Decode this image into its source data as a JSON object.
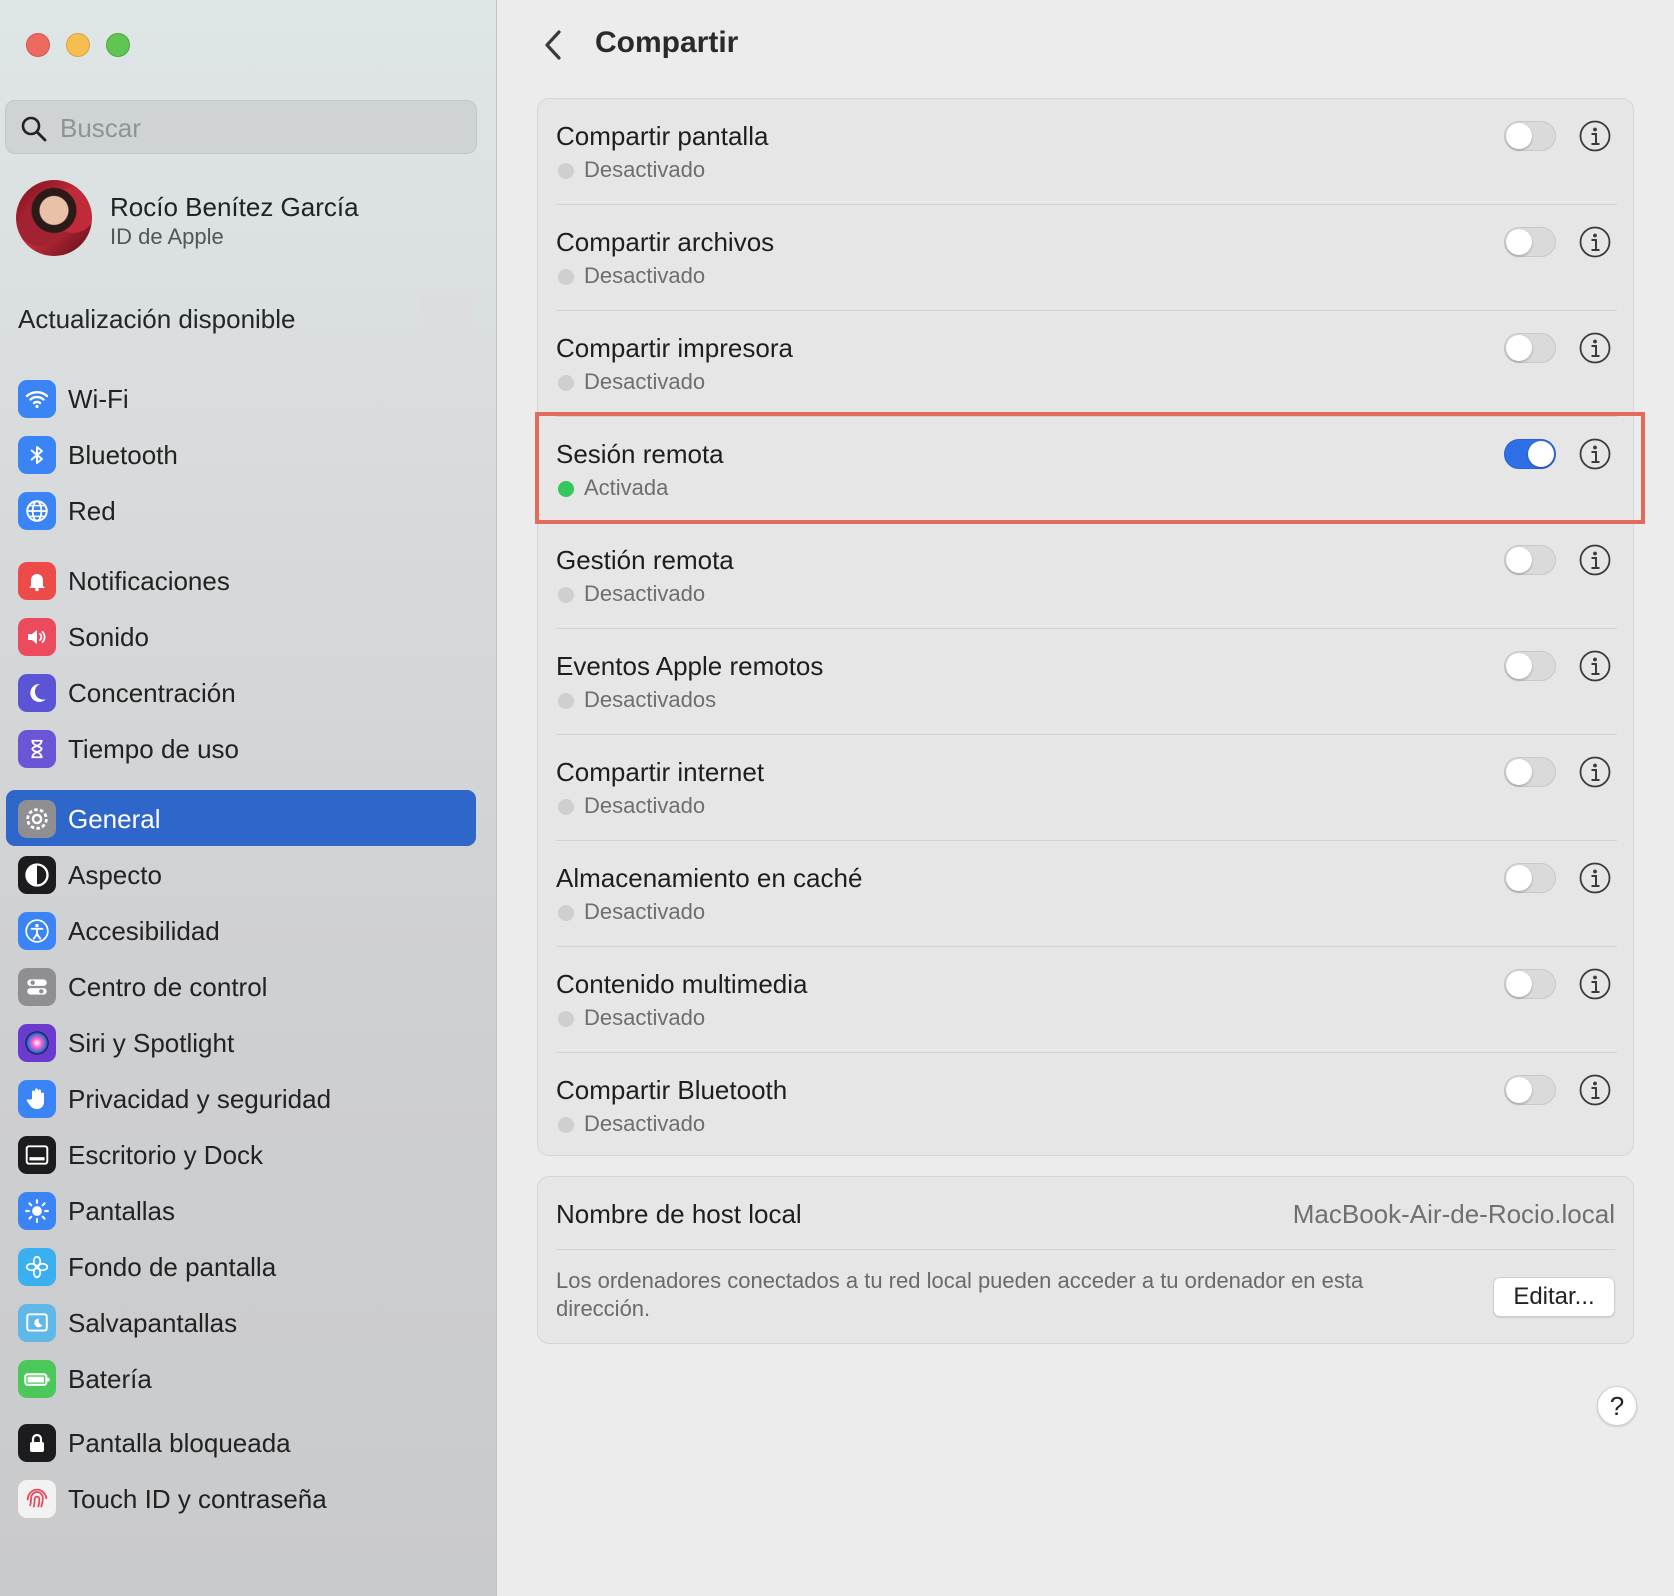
{
  "window": {
    "title": "Compartir"
  },
  "search": {
    "placeholder": "Buscar"
  },
  "profile": {
    "name": "Rocío Benítez García",
    "subtitle": "ID de Apple"
  },
  "sidebar": {
    "update_label": "Actualización disponible",
    "selected": "General",
    "groups": [
      [
        {
          "label": "Wi-Fi",
          "icon": "wifi-icon",
          "color": "#3a84f5"
        },
        {
          "label": "Bluetooth",
          "icon": "bluetooth-icon",
          "color": "#3a84f5"
        },
        {
          "label": "Red",
          "icon": "globe-icon",
          "color": "#3a84f5"
        }
      ],
      [
        {
          "label": "Notificaciones",
          "icon": "bell-icon",
          "color": "#ec4b47"
        },
        {
          "label": "Sonido",
          "icon": "speaker-icon",
          "color": "#ec4b5e"
        },
        {
          "label": "Concentración",
          "icon": "moon-icon",
          "color": "#5b55d6"
        },
        {
          "label": "Tiempo de uso",
          "icon": "hourglass-icon",
          "color": "#6a55d6"
        }
      ],
      [
        {
          "label": "General",
          "icon": "gear-icon",
          "color": "#8e8e93"
        },
        {
          "label": "Aspecto",
          "icon": "appearance-icon",
          "color": "#1c1c1e"
        },
        {
          "label": "Accesibilidad",
          "icon": "accessibility-icon",
          "color": "#3a84f5"
        },
        {
          "label": "Centro de control",
          "icon": "control-center-icon",
          "color": "#8e8e93"
        },
        {
          "label": "Siri y Spotlight",
          "icon": "siri-icon",
          "color": "#6b3bd0"
        },
        {
          "label": "Privacidad y seguridad",
          "icon": "hand-icon",
          "color": "#3a84f5"
        }
      ],
      [
        {
          "label": "Escritorio y Dock",
          "icon": "dock-icon",
          "color": "#1c1c1e"
        },
        {
          "label": "Pantallas",
          "icon": "sun-icon",
          "color": "#3a84f5"
        },
        {
          "label": "Fondo de pantalla",
          "icon": "flower-icon",
          "color": "#3ab0f0"
        },
        {
          "label": "Salvapantallas",
          "icon": "screensaver-icon",
          "color": "#5fb8e8"
        },
        {
          "label": "Batería",
          "icon": "battery-icon",
          "color": "#4cc75a"
        }
      ],
      [
        {
          "label": "Pantalla bloqueada",
          "icon": "lock-icon",
          "color": "#1c1c1e"
        },
        {
          "label": "Touch ID y contraseña",
          "icon": "fingerprint-icon",
          "color": "#f2f2f2"
        }
      ]
    ]
  },
  "sharing": {
    "services": [
      {
        "title": "Compartir pantalla",
        "status": "Desactivado",
        "on": false
      },
      {
        "title": "Compartir archivos",
        "status": "Desactivado",
        "on": false
      },
      {
        "title": "Compartir impresora",
        "status": "Desactivado",
        "on": false
      },
      {
        "title": "Sesión remota",
        "status": "Activada",
        "on": true
      },
      {
        "title": "Gestión remota",
        "status": "Desactivado",
        "on": false
      },
      {
        "title": "Eventos Apple remotos",
        "status": "Desactivados",
        "on": false
      },
      {
        "title": "Compartir internet",
        "status": "Desactivado",
        "on": false
      },
      {
        "title": "Almacenamiento en caché",
        "status": "Desactivado",
        "on": false
      },
      {
        "title": "Contenido multimedia",
        "status": "Desactivado",
        "on": false
      },
      {
        "title": "Compartir Bluetooth",
        "status": "Desactivado",
        "on": false
      }
    ],
    "host": {
      "label": "Nombre de host local",
      "value": "MacBook-Air-de-Rocio.local",
      "description": "Los ordenadores conectados a tu red local pueden acceder a tu ordenador en esta dirección.",
      "edit_label": "Editar..."
    },
    "help_label": "?"
  },
  "colors": {
    "accent": "#2f66c9",
    "toggle_on": "#2f6fe6",
    "highlight": "#e26b5b",
    "status_on": "#34c759"
  }
}
